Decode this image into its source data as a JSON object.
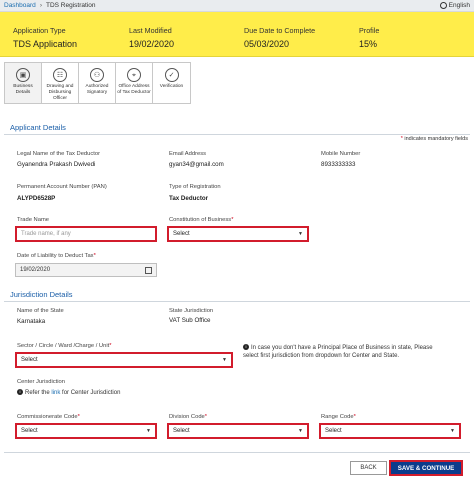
{
  "breadcrumb": {
    "home": "Dashboard",
    "separator": "›",
    "current": "TDS Registration"
  },
  "language": "English",
  "summary": {
    "labels": [
      "Application Type",
      "Last Modified",
      "Due Date to Complete",
      "Profile"
    ],
    "values": [
      "TDS Application",
      "19/02/2020",
      "05/03/2020",
      "15%"
    ]
  },
  "tabs": [
    {
      "label1": "Business",
      "label2": "Details",
      "icon": "briefcase-icon",
      "glyph": "▣"
    },
    {
      "label1": "Drawing and",
      "label2": "Disbursing Officer",
      "icon": "officer-icon",
      "glyph": "☷"
    },
    {
      "label1": "Authorized",
      "label2": "Signatory",
      "icon": "signatory-icon",
      "glyph": "⚇"
    },
    {
      "label1": "Office Address",
      "label2": "of Tax Deductor",
      "icon": "map-marker-icon",
      "glyph": "⌖"
    },
    {
      "label1": "Verification",
      "label2": "",
      "icon": "check-icon",
      "glyph": "✓"
    }
  ],
  "applicant": {
    "title": "Applicant Details",
    "mandatory_note": "indicates mandatory fields",
    "legal_name_label": "Legal Name of the Tax Deductor",
    "legal_name": "Gyanendra Prakash Dwivedi",
    "email_label": "Email Address",
    "email": "gyan34@gmail.com",
    "mobile_label": "Mobile Number",
    "mobile": "8933333333",
    "pan_label": "Permanent Account Number (PAN)",
    "pan": "ALYPD6528P",
    "reg_type_label": "Type of Registration",
    "reg_type": "Tax Deductor",
    "trade_name_label": "Trade Name",
    "trade_name_placeholder": "Trade name, if any",
    "constitution_label": "Constitution of Business",
    "constitution_value": "Select",
    "liability_label": "Date of Liability to Deduct Tax",
    "liability_date": "19/02/2020"
  },
  "jurisdiction": {
    "title": "Jurisdiction Details",
    "state_label": "Name of the State",
    "state": "Karnataka",
    "state_juris_label": "State Jurisdiction",
    "state_juris": "VAT Sub Office",
    "sector_label": "Sector / Circle / Ward /Charge / Unit",
    "sector_value": "Select",
    "info_line1": "In case you don't have a Principal Place of Business in state, Please",
    "info_line2": "select first jurisdiction from dropdown for Center and State.",
    "center_label": "Center Jurisdiction",
    "refer_pre": "Refer the",
    "refer_link": "link",
    "refer_post": "for Center Jurisdiction",
    "commissionerate_label": "Commissionerate Code",
    "commissionerate_value": "Select",
    "division_label": "Division Code",
    "division_value": "Select",
    "range_label": "Range Code",
    "range_value": "Select"
  },
  "buttons": {
    "back": "BACK",
    "save": "SAVE & CONTINUE"
  },
  "colors": {
    "banner": "#ffed4a",
    "link": "#1a6db0",
    "required": "#d21c2c",
    "primary": "#0b3c8c"
  }
}
